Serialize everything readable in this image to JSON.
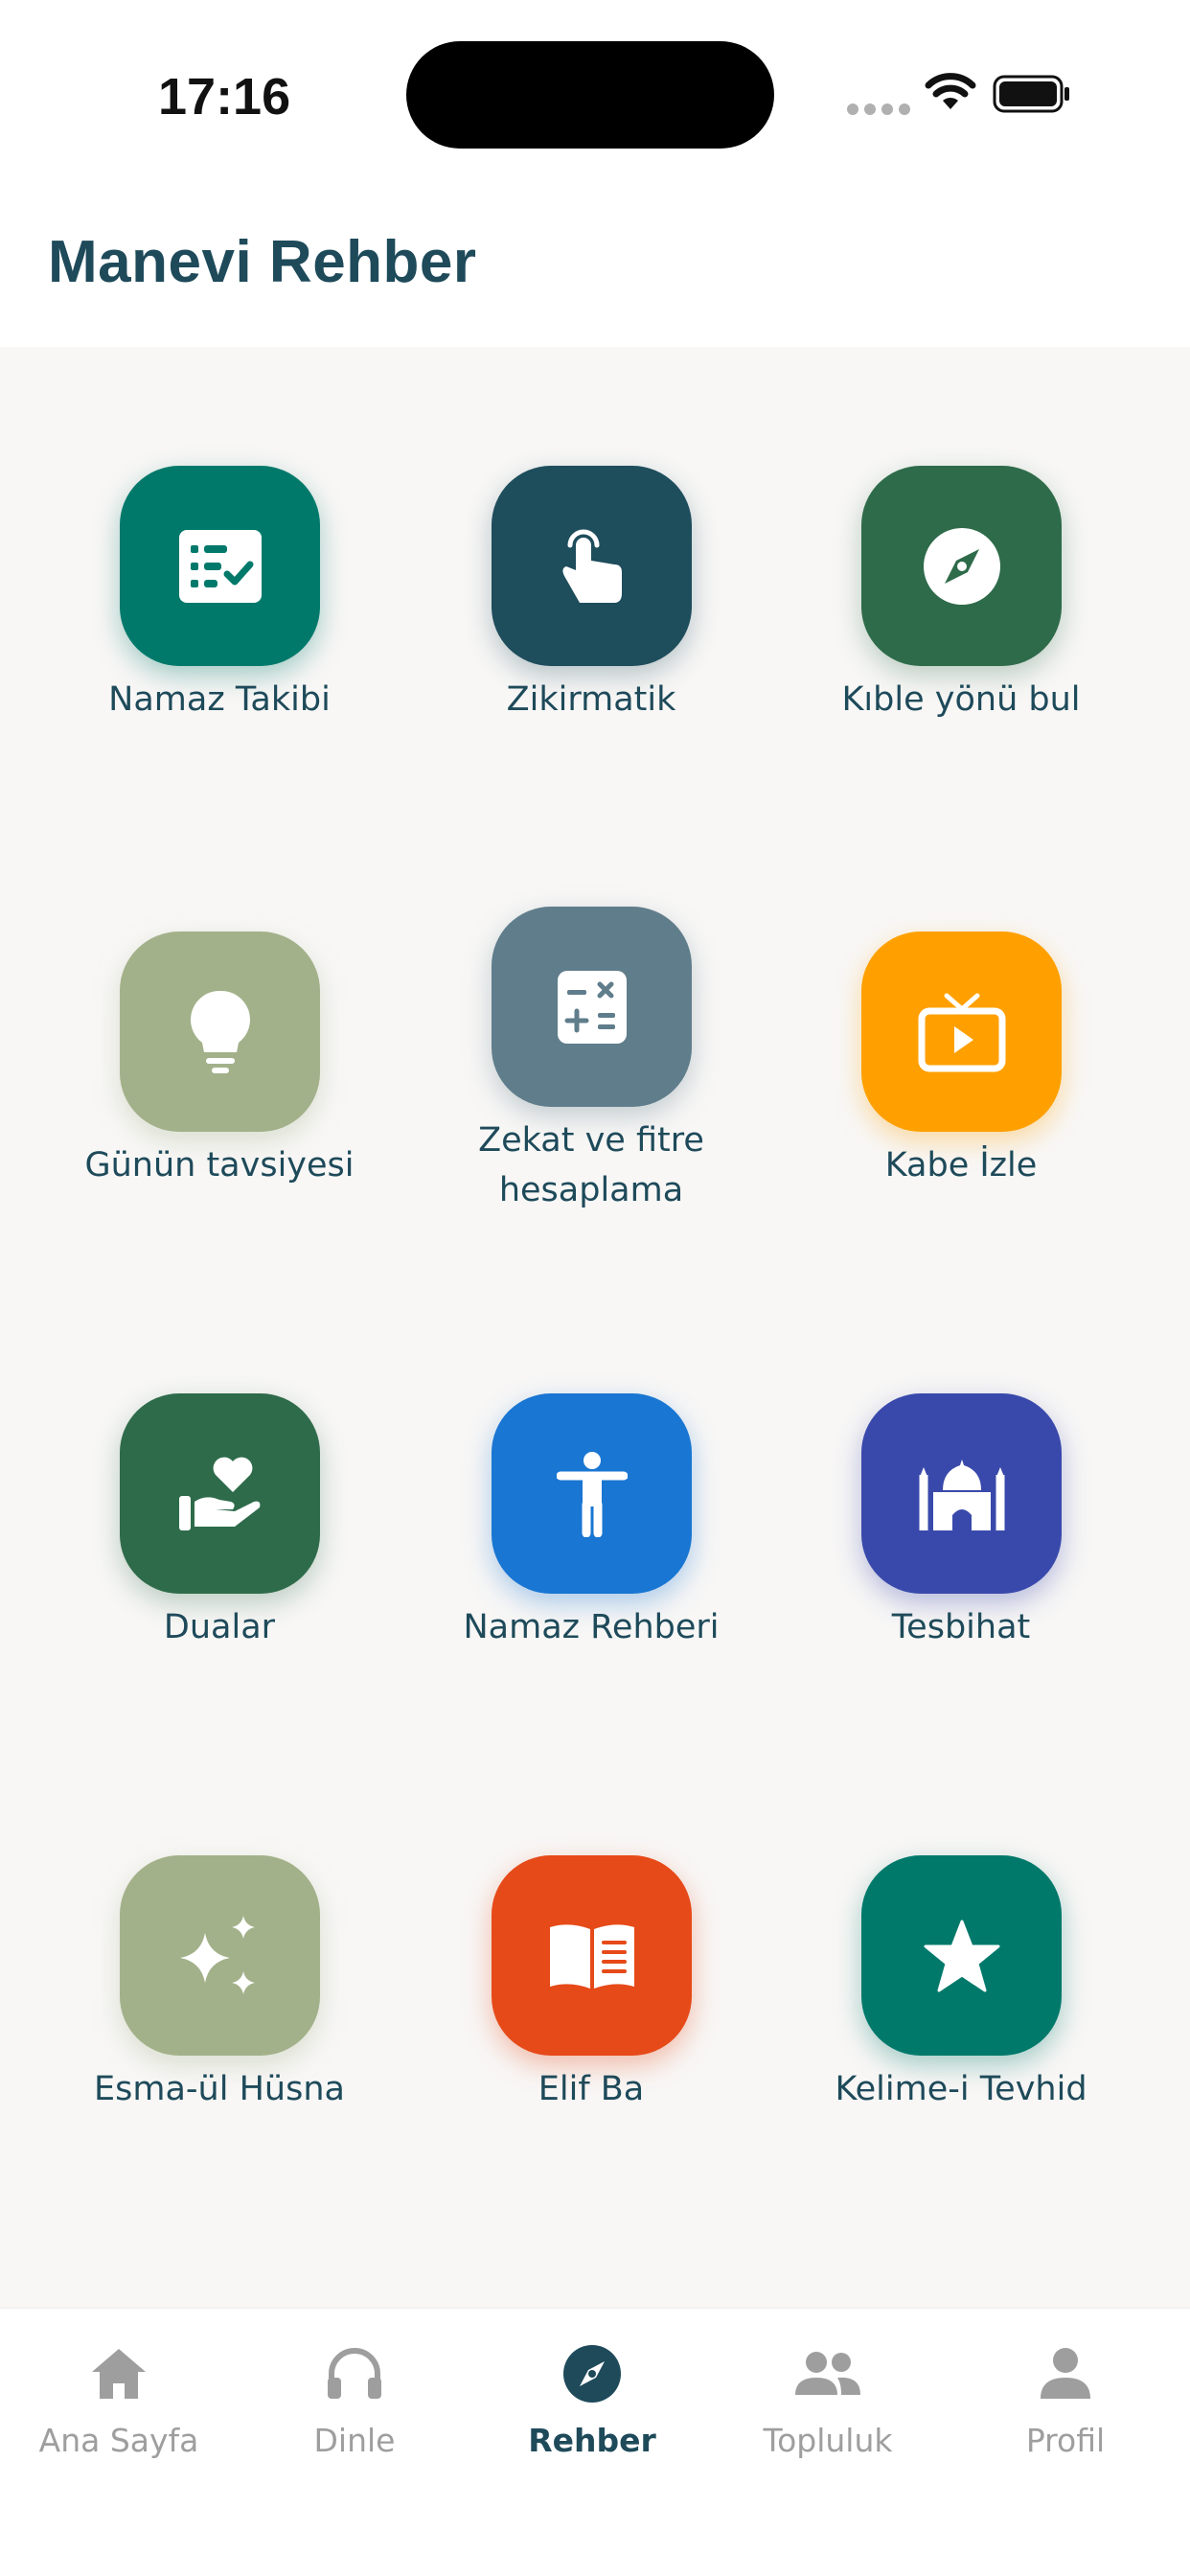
{
  "status": {
    "time": "17:16"
  },
  "header": {
    "title": "Manevi Rehber"
  },
  "tiles": [
    {
      "label": "Namaz Takibi",
      "color": "#00796b",
      "icon": "checklist-icon"
    },
    {
      "label": "Zikirmatik",
      "color": "#1e4d5c",
      "icon": "tap-hand-icon"
    },
    {
      "label": "Kıble yönü bul",
      "color": "#2e6b4a",
      "icon": "compass-icon"
    },
    {
      "label": "Günün tavsiyesi",
      "color": "#a3b18a",
      "icon": "lightbulb-icon"
    },
    {
      "label": "Zekat ve fitre hesaplama",
      "label_line1": "Zekat ve fitre",
      "label_line2": "hesaplama",
      "color": "#607d8b",
      "icon": "calculator-icon"
    },
    {
      "label": "Kabe İzle",
      "color": "#ffa000",
      "icon": "tv-play-icon"
    },
    {
      "label": "Dualar",
      "color": "#2e6b4a",
      "icon": "hand-heart-icon"
    },
    {
      "label": "Namaz Rehberi",
      "color": "#1976d2",
      "icon": "person-accessibility-icon"
    },
    {
      "label": "Tesbihat",
      "color": "#3949ab",
      "icon": "mosque-icon"
    },
    {
      "label": "Esma-ül Hüsna",
      "color": "#a3b18a",
      "icon": "sparkles-icon"
    },
    {
      "label": "Elif Ba",
      "color": "#e64a19",
      "icon": "open-book-icon"
    },
    {
      "label": "Kelime-i Tevhid",
      "color": "#00796b",
      "icon": "star-icon"
    }
  ],
  "tabs": [
    {
      "label": "Ana Sayfa",
      "icon": "home-icon",
      "active": false
    },
    {
      "label": "Dinle",
      "icon": "headphones-icon",
      "active": false
    },
    {
      "label": "Rehber",
      "icon": "compass-icon",
      "active": true
    },
    {
      "label": "Topluluk",
      "icon": "people-icon",
      "active": false
    },
    {
      "label": "Profil",
      "icon": "person-icon",
      "active": false
    }
  ],
  "colors": {
    "primary": "#1e4a5a",
    "inactive": "#9e9e9e",
    "background": "#f8f7f6"
  }
}
